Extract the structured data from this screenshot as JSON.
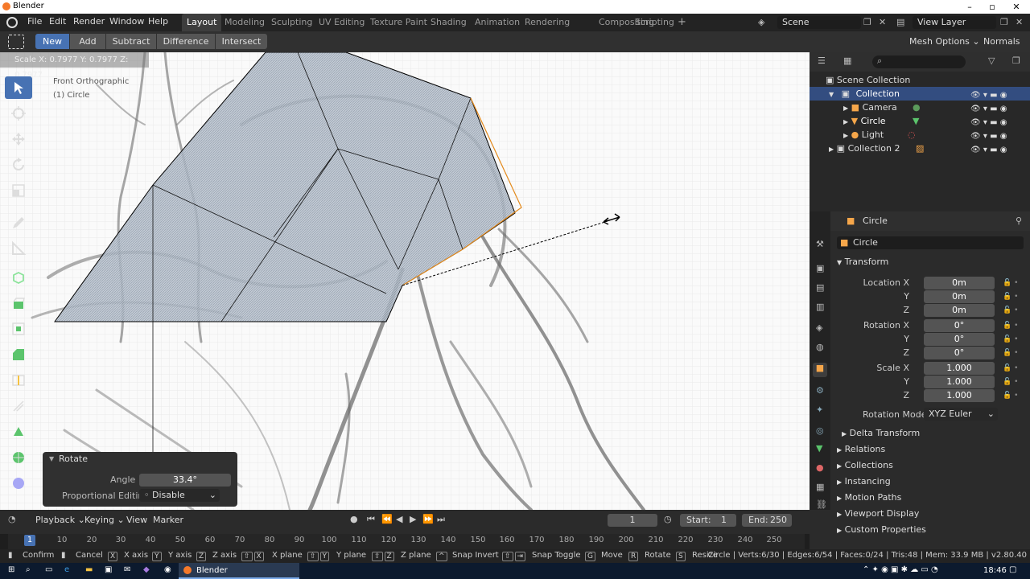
{
  "window": {
    "title": "Blender"
  },
  "menu": {
    "items": [
      "File",
      "Edit",
      "Render",
      "Window",
      "Help"
    ]
  },
  "workspaces": [
    "Layout",
    "Modeling",
    "Sculpting",
    "UV Editing",
    "Texture Paint",
    "Shading",
    "Animation",
    "Rendering",
    "Compositing",
    "Scripting"
  ],
  "scene": {
    "scene_name": "Scene",
    "view_layer": "View Layer"
  },
  "tool_header": {
    "modes": [
      "New",
      "Add",
      "Subtract",
      "Difference",
      "Intersect"
    ],
    "mesh_options": "Mesh Options",
    "normals": "Normals"
  },
  "viewport": {
    "scale_readout": "Scale X: 0.7977   Y: 0.7977   Z: 0.7977",
    "view_name": "Front Orthographic",
    "object_label": "(1) Circle"
  },
  "operator": {
    "title": "Rotate",
    "angle_label": "Angle",
    "angle_value": "33.4°",
    "prop_label": "Proportional Editing",
    "prop_value": "Disable"
  },
  "outliner": {
    "root": "Scene Collection",
    "items": [
      "Collection",
      "Camera",
      "Circle",
      "Light",
      "Collection 2"
    ]
  },
  "properties": {
    "object_header": "Circle",
    "object_name": "Circle",
    "transform_title": "Transform",
    "location": {
      "label": "Location X",
      "x": "0m",
      "y": "0m",
      "z": "0m"
    },
    "rotation": {
      "label": "Rotation X",
      "x": "0°",
      "y": "0°",
      "z": "0°"
    },
    "scale": {
      "label": "Scale X",
      "x": "1.000",
      "y": "1.000",
      "z": "1.000"
    },
    "axis_y": "Y",
    "axis_z": "Z",
    "rotation_mode_label": "Rotation Mode",
    "rotation_mode_value": "XYZ Euler",
    "panels": [
      "Delta Transform",
      "Relations",
      "Collections",
      "Instancing",
      "Motion Paths",
      "Viewport Display",
      "Custom Properties"
    ]
  },
  "timeline": {
    "menus": [
      "Playback",
      "Keying",
      "View",
      "Marker"
    ],
    "current_frame": "1",
    "start_label": "Start:",
    "start": "1",
    "end_label": "End:",
    "end": "250",
    "ticks": [
      "10",
      "20",
      "30",
      "40",
      "50",
      "60",
      "70",
      "80",
      "90",
      "100",
      "110",
      "120",
      "130",
      "140",
      "150",
      "160",
      "170",
      "180",
      "190",
      "200",
      "210",
      "220",
      "230",
      "240",
      "250"
    ],
    "ruler_current": "1"
  },
  "statusbar": {
    "items": [
      "Confirm",
      "Cancel",
      "X axis",
      "Y axis",
      "Z axis",
      "X plane",
      "Y plane",
      "Z plane",
      "Snap Invert",
      "Snap Toggle",
      "Move",
      "Rotate",
      "Resize"
    ],
    "keys": [
      "X",
      "Y",
      "Z",
      "X",
      "Y",
      "Z",
      "G",
      "R",
      "S"
    ],
    "stats": "Circle | Verts:6/30 | Edges:6/54 | Faces:0/24 | Tris:48 | Mem: 33.9 MB | v2.80.40"
  },
  "taskbar": {
    "app": "Blender",
    "time": "18:46"
  }
}
